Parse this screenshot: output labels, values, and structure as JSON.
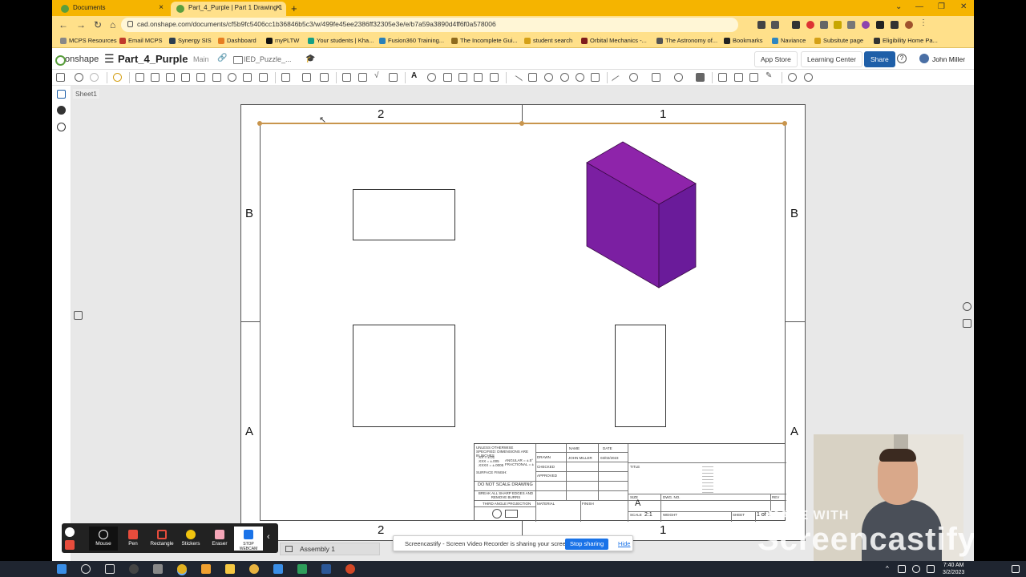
{
  "browser": {
    "tabs": [
      {
        "title": "Documents",
        "active": false
      },
      {
        "title": "Part_4_Purple | Part 1 Drawing 1",
        "active": true
      }
    ],
    "url": "cad.onshape.com/documents/cf5b9fc5406cc1b36846b5c3/w/499fe45ee2386ff32305e3e/e/b7a59a3890d4ff6f0a578006",
    "bookmarks": [
      "MCPS Resources",
      "Email MCPS",
      "Synergy SIS",
      "Dashboard",
      "myPLTW",
      "Your students | Kha...",
      "Fusion360 Training...",
      "The Incomplete Gui...",
      "student search",
      "Orbital Mechanics -...",
      "The Astronomy of...",
      "Bookmarks",
      "Naviance",
      "Subsitute page",
      "Eligibility Home Pa..."
    ]
  },
  "onshape": {
    "logo": "onshape",
    "doc_name": "Part_4_Purple",
    "branch": "Main",
    "folder": "IED_Puzzle_...",
    "app_store": "App Store",
    "learning_center": "Learning Center",
    "share": "Share",
    "user": "John Miller",
    "sheet_tab": "Sheet1",
    "bottom_tab": "Assembly 1"
  },
  "drawing": {
    "top_zones": [
      "2",
      "1"
    ],
    "bottom_zones": [
      "2",
      "1"
    ],
    "left_zones": [
      "B",
      "A"
    ],
    "right_zones": [
      "B",
      "A"
    ],
    "part_color": "#7b1fa2",
    "title_block": {
      "tolerance_note": "UNLESS OTHERWISE SPECIFIED: DIMENSIONS ARE IN INCHES",
      "tol1": ".XX = ±.01",
      "tol2": ".XXX = ±.005",
      "tol3": ".XXXX = ±.0005",
      "angular": "ANGULAR = ±.5°",
      "fractional": "FRACTIONAL = ±",
      "surface": "SURFACE FINISH:",
      "do_not_scale": "DO NOT SCALE DRAWING",
      "break_edges": "BREAK ALL SHARP EDGES AND REMOVE BURRS",
      "projection": "THIRD ANGLE PROJECTION",
      "name_hdr": "NAME",
      "date_hdr": "DATE",
      "drawn": "DRAWN",
      "checked": "CHECKED",
      "approved": "APPROVED",
      "drawn_name": "JOHN MILLER",
      "drawn_date": "03/02/2023",
      "material": "MATERIAL",
      "finish": "FINISH",
      "title": "TITLE",
      "size_lbl": "SIZE",
      "size": "A",
      "dwg_no": "DWG. NO.",
      "rev": "REV",
      "scale_lbl": "SCALE",
      "scale": "2:1",
      "weight": "WEIGHT",
      "sheet_lbl": "SHEET",
      "sheet": "1 of 1"
    }
  },
  "screencastify": {
    "tools": [
      "Mouse",
      "Pen",
      "Rectangle",
      "Stickers",
      "Eraser",
      "STOP WEBCAM"
    ],
    "banner": "Screencastify - Screen Video Recorder is sharing your screen.",
    "stop_sharing": "Stop sharing",
    "hide": "Hide",
    "watermark_made": "MADE WITH",
    "watermark_brand": "Screencastify"
  },
  "taskbar": {
    "time": "7:40 AM",
    "date": "3/2/2023"
  }
}
